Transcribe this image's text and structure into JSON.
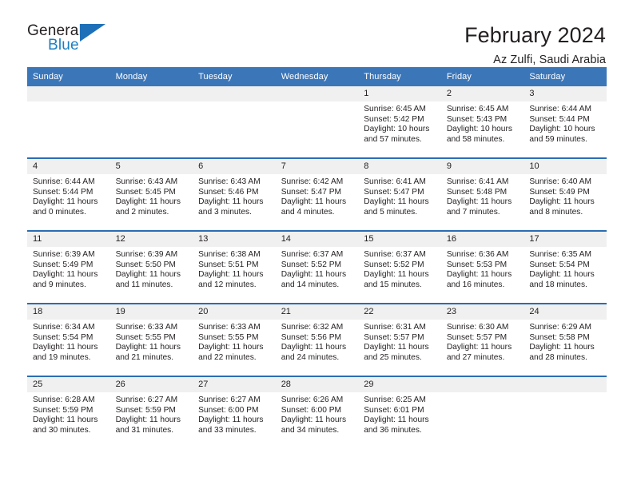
{
  "brand": {
    "name_part1": "General",
    "name_part2": "Blue",
    "accent_color": "#1a7fc1",
    "triangle_color": "#1d70b8",
    "logo_icon": "blue-triangle-icon"
  },
  "header": {
    "title": "February 2024",
    "subtitle": "Az Zulfi, Saudi Arabia"
  },
  "theme": {
    "header_row_bg": "#3b76b9",
    "row_border": "#2a6db3",
    "daynum_bg": "#f0f0f0",
    "text": "#231f20"
  },
  "columns": [
    "Sunday",
    "Monday",
    "Tuesday",
    "Wednesday",
    "Thursday",
    "Friday",
    "Saturday"
  ],
  "labels": {
    "sunrise_prefix": "Sunrise:",
    "sunset_prefix": "Sunset:",
    "daylight_prefix": "Daylight:"
  },
  "weeks": [
    [
      {
        "day": "",
        "empty": true
      },
      {
        "day": "",
        "empty": true
      },
      {
        "day": "",
        "empty": true
      },
      {
        "day": "",
        "empty": true
      },
      {
        "day": "1",
        "sunrise": "Sunrise: 6:45 AM",
        "sunset": "Sunset: 5:42 PM",
        "daylight_l1": "Daylight: 10 hours",
        "daylight_l2": "and 57 minutes."
      },
      {
        "day": "2",
        "sunrise": "Sunrise: 6:45 AM",
        "sunset": "Sunset: 5:43 PM",
        "daylight_l1": "Daylight: 10 hours",
        "daylight_l2": "and 58 minutes."
      },
      {
        "day": "3",
        "sunrise": "Sunrise: 6:44 AM",
        "sunset": "Sunset: 5:44 PM",
        "daylight_l1": "Daylight: 10 hours",
        "daylight_l2": "and 59 minutes."
      }
    ],
    [
      {
        "day": "4",
        "sunrise": "Sunrise: 6:44 AM",
        "sunset": "Sunset: 5:44 PM",
        "daylight_l1": "Daylight: 11 hours",
        "daylight_l2": "and 0 minutes."
      },
      {
        "day": "5",
        "sunrise": "Sunrise: 6:43 AM",
        "sunset": "Sunset: 5:45 PM",
        "daylight_l1": "Daylight: 11 hours",
        "daylight_l2": "and 2 minutes."
      },
      {
        "day": "6",
        "sunrise": "Sunrise: 6:43 AM",
        "sunset": "Sunset: 5:46 PM",
        "daylight_l1": "Daylight: 11 hours",
        "daylight_l2": "and 3 minutes."
      },
      {
        "day": "7",
        "sunrise": "Sunrise: 6:42 AM",
        "sunset": "Sunset: 5:47 PM",
        "daylight_l1": "Daylight: 11 hours",
        "daylight_l2": "and 4 minutes."
      },
      {
        "day": "8",
        "sunrise": "Sunrise: 6:41 AM",
        "sunset": "Sunset: 5:47 PM",
        "daylight_l1": "Daylight: 11 hours",
        "daylight_l2": "and 5 minutes."
      },
      {
        "day": "9",
        "sunrise": "Sunrise: 6:41 AM",
        "sunset": "Sunset: 5:48 PM",
        "daylight_l1": "Daylight: 11 hours",
        "daylight_l2": "and 7 minutes."
      },
      {
        "day": "10",
        "sunrise": "Sunrise: 6:40 AM",
        "sunset": "Sunset: 5:49 PM",
        "daylight_l1": "Daylight: 11 hours",
        "daylight_l2": "and 8 minutes."
      }
    ],
    [
      {
        "day": "11",
        "sunrise": "Sunrise: 6:39 AM",
        "sunset": "Sunset: 5:49 PM",
        "daylight_l1": "Daylight: 11 hours",
        "daylight_l2": "and 9 minutes."
      },
      {
        "day": "12",
        "sunrise": "Sunrise: 6:39 AM",
        "sunset": "Sunset: 5:50 PM",
        "daylight_l1": "Daylight: 11 hours",
        "daylight_l2": "and 11 minutes."
      },
      {
        "day": "13",
        "sunrise": "Sunrise: 6:38 AM",
        "sunset": "Sunset: 5:51 PM",
        "daylight_l1": "Daylight: 11 hours",
        "daylight_l2": "and 12 minutes."
      },
      {
        "day": "14",
        "sunrise": "Sunrise: 6:37 AM",
        "sunset": "Sunset: 5:52 PM",
        "daylight_l1": "Daylight: 11 hours",
        "daylight_l2": "and 14 minutes."
      },
      {
        "day": "15",
        "sunrise": "Sunrise: 6:37 AM",
        "sunset": "Sunset: 5:52 PM",
        "daylight_l1": "Daylight: 11 hours",
        "daylight_l2": "and 15 minutes."
      },
      {
        "day": "16",
        "sunrise": "Sunrise: 6:36 AM",
        "sunset": "Sunset: 5:53 PM",
        "daylight_l1": "Daylight: 11 hours",
        "daylight_l2": "and 16 minutes."
      },
      {
        "day": "17",
        "sunrise": "Sunrise: 6:35 AM",
        "sunset": "Sunset: 5:54 PM",
        "daylight_l1": "Daylight: 11 hours",
        "daylight_l2": "and 18 minutes."
      }
    ],
    [
      {
        "day": "18",
        "sunrise": "Sunrise: 6:34 AM",
        "sunset": "Sunset: 5:54 PM",
        "daylight_l1": "Daylight: 11 hours",
        "daylight_l2": "and 19 minutes."
      },
      {
        "day": "19",
        "sunrise": "Sunrise: 6:33 AM",
        "sunset": "Sunset: 5:55 PM",
        "daylight_l1": "Daylight: 11 hours",
        "daylight_l2": "and 21 minutes."
      },
      {
        "day": "20",
        "sunrise": "Sunrise: 6:33 AM",
        "sunset": "Sunset: 5:55 PM",
        "daylight_l1": "Daylight: 11 hours",
        "daylight_l2": "and 22 minutes."
      },
      {
        "day": "21",
        "sunrise": "Sunrise: 6:32 AM",
        "sunset": "Sunset: 5:56 PM",
        "daylight_l1": "Daylight: 11 hours",
        "daylight_l2": "and 24 minutes."
      },
      {
        "day": "22",
        "sunrise": "Sunrise: 6:31 AM",
        "sunset": "Sunset: 5:57 PM",
        "daylight_l1": "Daylight: 11 hours",
        "daylight_l2": "and 25 minutes."
      },
      {
        "day": "23",
        "sunrise": "Sunrise: 6:30 AM",
        "sunset": "Sunset: 5:57 PM",
        "daylight_l1": "Daylight: 11 hours",
        "daylight_l2": "and 27 minutes."
      },
      {
        "day": "24",
        "sunrise": "Sunrise: 6:29 AM",
        "sunset": "Sunset: 5:58 PM",
        "daylight_l1": "Daylight: 11 hours",
        "daylight_l2": "and 28 minutes."
      }
    ],
    [
      {
        "day": "25",
        "sunrise": "Sunrise: 6:28 AM",
        "sunset": "Sunset: 5:59 PM",
        "daylight_l1": "Daylight: 11 hours",
        "daylight_l2": "and 30 minutes."
      },
      {
        "day": "26",
        "sunrise": "Sunrise: 6:27 AM",
        "sunset": "Sunset: 5:59 PM",
        "daylight_l1": "Daylight: 11 hours",
        "daylight_l2": "and 31 minutes."
      },
      {
        "day": "27",
        "sunrise": "Sunrise: 6:27 AM",
        "sunset": "Sunset: 6:00 PM",
        "daylight_l1": "Daylight: 11 hours",
        "daylight_l2": "and 33 minutes."
      },
      {
        "day": "28",
        "sunrise": "Sunrise: 6:26 AM",
        "sunset": "Sunset: 6:00 PM",
        "daylight_l1": "Daylight: 11 hours",
        "daylight_l2": "and 34 minutes."
      },
      {
        "day": "29",
        "sunrise": "Sunrise: 6:25 AM",
        "sunset": "Sunset: 6:01 PM",
        "daylight_l1": "Daylight: 11 hours",
        "daylight_l2": "and 36 minutes."
      },
      {
        "day": "",
        "empty": true
      },
      {
        "day": "",
        "empty": true
      }
    ]
  ]
}
